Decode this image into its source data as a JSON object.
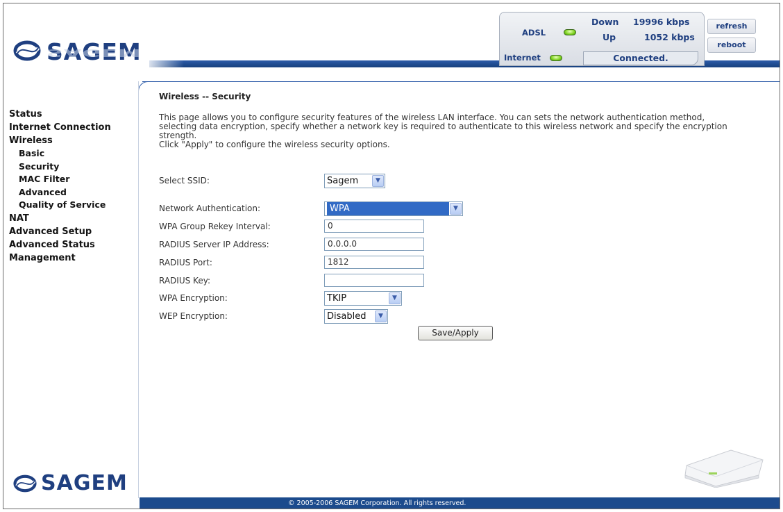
{
  "brand": {
    "logo_text": "SAGEM",
    "colors": {
      "primary": "#1f3f80",
      "band": "#2c5ba8",
      "footer": "#1c4b8d",
      "led": "#7ed21f"
    }
  },
  "status": {
    "adsl_label": "ADSL",
    "internet_label": "Internet",
    "down_label": "Down",
    "down_value": "19996 kbps",
    "up_label": "Up",
    "up_value": "1052 kbps",
    "connection_state": "Connected.",
    "refresh_label": "refresh",
    "reboot_label": "reboot"
  },
  "nav": {
    "items": [
      {
        "label": "Status"
      },
      {
        "label": "Internet Connection"
      },
      {
        "label": "Wireless"
      },
      {
        "label": "Basic"
      },
      {
        "label": "Security"
      },
      {
        "label": "MAC Filter"
      },
      {
        "label": "Advanced"
      },
      {
        "label": "Quality of Service"
      },
      {
        "label": "NAT"
      },
      {
        "label": "Advanced Setup"
      },
      {
        "label": "Advanced Status"
      },
      {
        "label": "Management"
      }
    ]
  },
  "page": {
    "title": "Wireless -- Security",
    "description_1": "This page allows you to configure security features of the wireless LAN interface. You can sets the network authentication method, selecting data encryption, specify whether a network key is required to authenticate to this wireless network and specify the encryption strength.",
    "description_2": "Click \"Apply\" to configure the wireless security options."
  },
  "form": {
    "ssid": {
      "label": "Select SSID:",
      "value": "Sagem"
    },
    "auth": {
      "label": "Network Authentication:",
      "value": "WPA"
    },
    "rekey": {
      "label": "WPA Group Rekey Interval:",
      "value": "0"
    },
    "radius_ip": {
      "label": "RADIUS Server IP Address:",
      "value": "0.0.0.0"
    },
    "radius_port": {
      "label": "RADIUS Port:",
      "value": "1812"
    },
    "radius_key": {
      "label": "RADIUS Key:",
      "value": ""
    },
    "wpa_enc": {
      "label": "WPA Encryption:",
      "value": "TKIP"
    },
    "wep_enc": {
      "label": "WEP Encryption:",
      "value": "Disabled"
    },
    "save_label": "Save/Apply"
  },
  "footer": {
    "copyright": "© 2005-2006 SAGEM Corporation. All rights reserved."
  }
}
